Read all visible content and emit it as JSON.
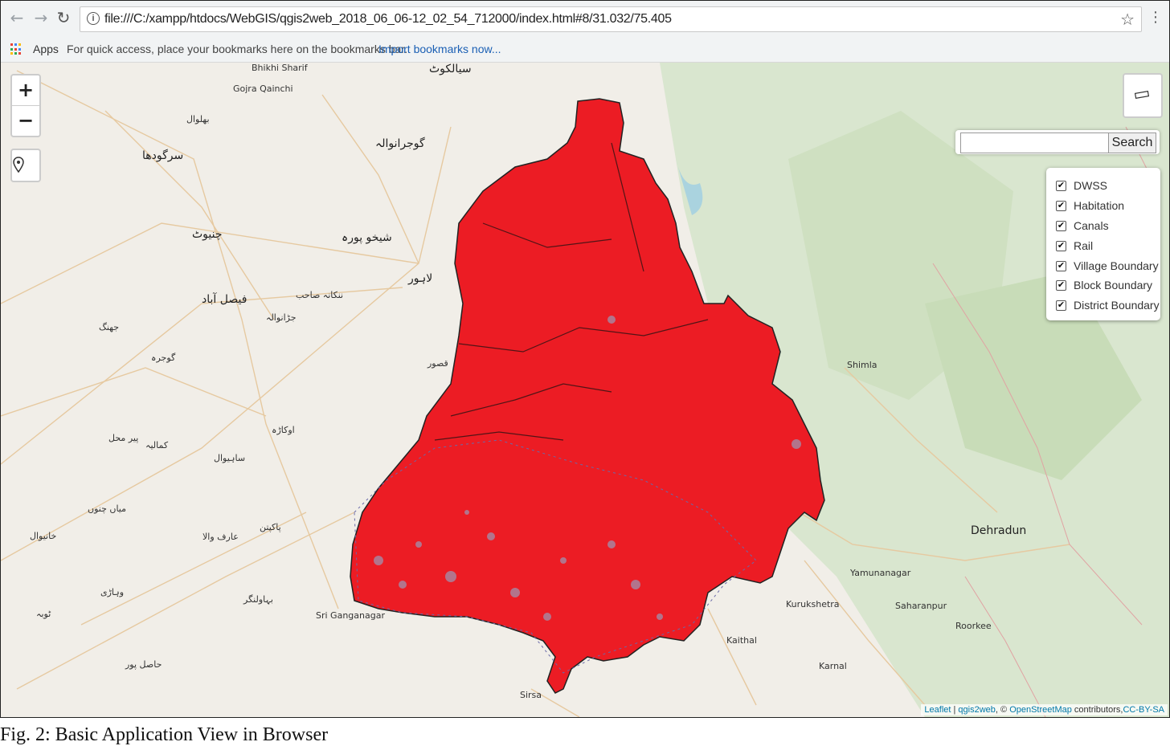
{
  "browser": {
    "url": "file:///C:/xampp/htdocs/WebGIS/qgis2web_2018_06_06-12_02_54_712000/index.html#8/31.032/75.405",
    "apps_label": "Apps",
    "bookmarks_hint": "For quick access, place your bookmarks here on the bookmarks bar.",
    "import_link": "Import bookmarks now..."
  },
  "map": {
    "zoom_in": "+",
    "zoom_out": "−",
    "search_button": "Search",
    "search_value": "",
    "layers": [
      {
        "label": "DWSS",
        "checked": true
      },
      {
        "label": "Habitation",
        "checked": true
      },
      {
        "label": "Canals",
        "checked": true
      },
      {
        "label": "Rail",
        "checked": true
      },
      {
        "label": "Village Boundary",
        "checked": true
      },
      {
        "label": "Block Boundary",
        "checked": true
      },
      {
        "label": "District Boundary",
        "checked": true
      }
    ],
    "check_glyph": "✔",
    "attribution": {
      "leaflet": "Leaflet",
      "sep1": " | ",
      "qgis2web": "qgis2web",
      "mid": ", © ",
      "osm": "OpenStreetMap",
      "contrib": " contributors,",
      "license": "CC-BY-SA"
    },
    "places": {
      "shimla": "Shimla",
      "dehradun": "Dehradun",
      "yamunanagar": "Yamunanagar",
      "saharanpur": "Saharanpur",
      "kurukshetra": "Kurukshetra",
      "roorkee": "Roorkee",
      "kaithal": "Kaithal",
      "karnal": "Karnal",
      "sri_ganganagar": "Sri Ganganagar",
      "sirsa": "Sirsa",
      "bhikhi_sharif": "Bhikhi Sharif",
      "gojra_qainchi": "Gojra Qainchi",
      "sialkot": "سیالکوٹ",
      "gujranwala": "گوجرانوالہ",
      "sargodha": "سرگودھا",
      "chiniot": "چنیوٹ",
      "sheikhupura": "شیخو پورہ",
      "lahore": "لاہور",
      "faisalabad": "فیصل آباد",
      "jhang": "جھنگ",
      "kasur": "قصور",
      "okara": "اوکاڑہ",
      "sahiwal": "ساہیوال",
      "pakpattan": "پاکپتن",
      "khanewal": "خانیوال",
      "vehari": "وہاڑی",
      "bahawalnagar": "بہاولنگر",
      "mian_channu": "میاں چنوں",
      "kamalia": "کمالیہ",
      "arifwala": "عارف والا",
      "bhalwal": "بھلوال",
      "pirmahal": "پیر محل",
      "toba": "ٹوبہ",
      "hasilpur": "حاصل پور",
      "nankana": "ننکانہ صاحب",
      "jaranwala": "جڑانوالہ",
      "gojra": "گوجرہ"
    }
  },
  "caption": "Fig. 2: Basic Application View in Browser"
}
